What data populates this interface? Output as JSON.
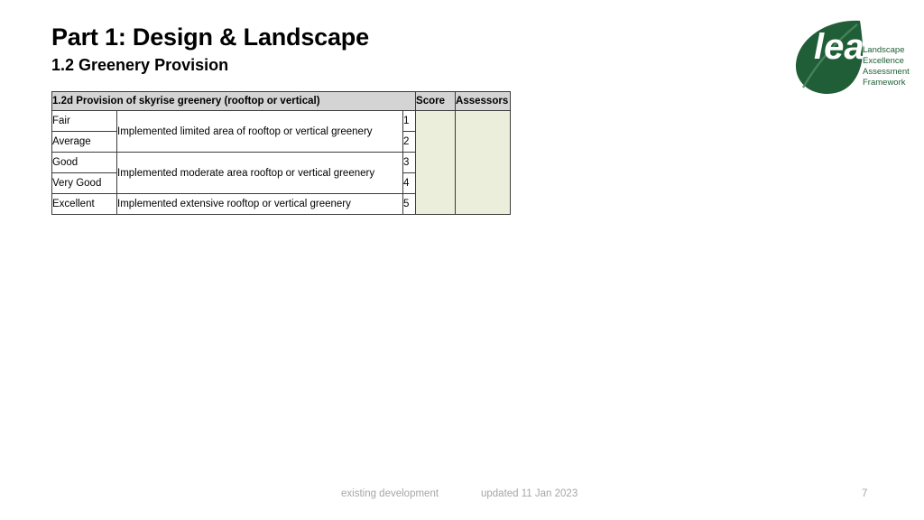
{
  "slide": {
    "title": "Part 1: Design & Landscape",
    "subtitle": "1.2 Greenery Provision"
  },
  "logo": {
    "wordmark": "leaf",
    "tagline_lines": [
      "Landscape",
      "Excellence",
      "Assessment",
      "Framework"
    ],
    "leaf_color": "#1f5e36",
    "text_color": "#1f5e36",
    "wordmark_color": "#ffffff"
  },
  "table": {
    "headers": {
      "criterion": "1.2d Provision of skyrise greenery (rooftop or vertical)",
      "score": "Score",
      "assessors": "Assessors"
    },
    "header_bg": "#d4d4d4",
    "fill_bg": "#eaeedb",
    "border_color": "#3c3c3c",
    "rows": [
      {
        "rating": "Fair",
        "description": "Implemented limited area of rooftop or vertical greenery",
        "number": "1"
      },
      {
        "rating": "Average",
        "description": "",
        "number": "2"
      },
      {
        "rating": "Good",
        "description": "Implemented moderate area rooftop or vertical greenery",
        "number": "3"
      },
      {
        "rating": "Very Good",
        "description": "",
        "number": "4"
      },
      {
        "rating": "Excellent",
        "description": "Implemented extensive rooftop or vertical greenery",
        "number": "5"
      }
    ]
  },
  "footer": {
    "context": "existing development",
    "updated": "updated  11 Jan 2023",
    "page_number": "7"
  }
}
